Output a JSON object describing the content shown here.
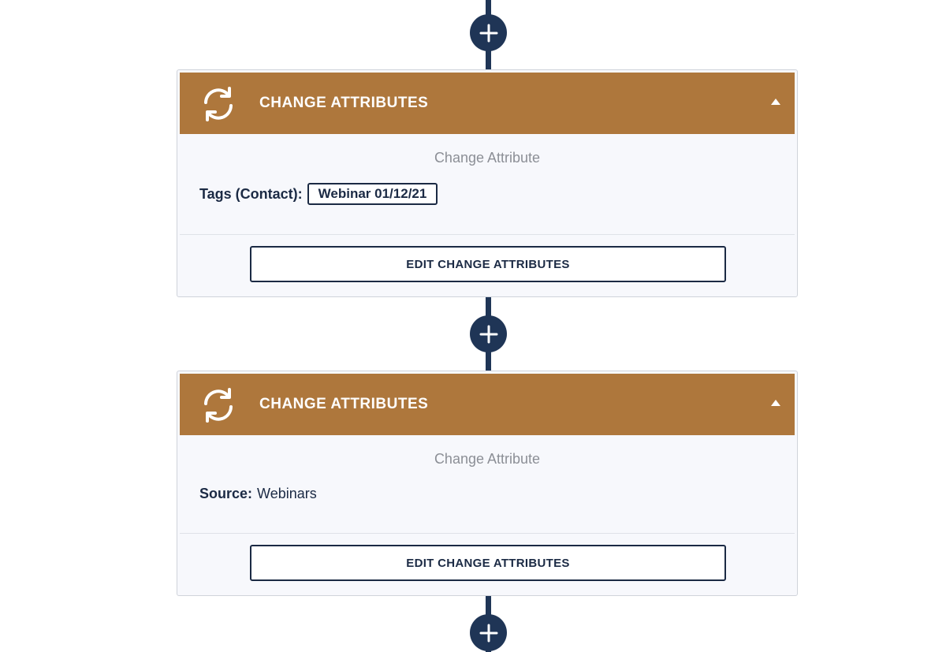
{
  "workflow": {
    "steps": [
      {
        "title": "CHANGE ATTRIBUTES",
        "subtitle": "Change Attribute",
        "attribute_key": "Tags (Contact):",
        "attribute_tag": "Webinar 01/12/21",
        "edit_label": "EDIT CHANGE ATTRIBUTES",
        "icon": "refresh-icon",
        "toggle_icon": "caret-up-icon"
      },
      {
        "title": "CHANGE ATTRIBUTES",
        "subtitle": "Change Attribute",
        "attribute_key": "Source:",
        "attribute_value": "Webinars",
        "edit_label": "EDIT CHANGE ATTRIBUTES",
        "icon": "refresh-icon",
        "toggle_icon": "caret-up-icon"
      }
    ],
    "add_step_icon": "plus-icon"
  },
  "colors": {
    "header": "#ae773c",
    "connector": "#1f3556",
    "text": "#1b2a44",
    "muted": "#8c8f96",
    "card_bg": "#f7f8fc"
  }
}
